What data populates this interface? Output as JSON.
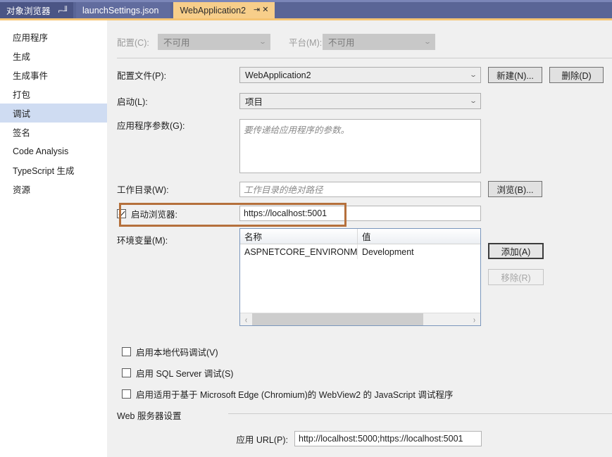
{
  "window": {
    "tabs": [
      {
        "label": "对象浏览器",
        "type": "dock",
        "pin_icon": "pin-icon",
        "active": false
      },
      {
        "label": "launchSettings.json",
        "type": "document",
        "active": false
      },
      {
        "label": "WebApplication2",
        "type": "document",
        "active": true,
        "pin_icon": "pin-icon",
        "close_icon": "close-icon"
      }
    ]
  },
  "sidebar": {
    "items": [
      {
        "label": "应用程序",
        "selected": false
      },
      {
        "label": "生成",
        "selected": false
      },
      {
        "label": "生成事件",
        "selected": false
      },
      {
        "label": "打包",
        "selected": false
      },
      {
        "label": "调试",
        "selected": true
      },
      {
        "label": "签名",
        "selected": false
      },
      {
        "label": "Code Analysis",
        "selected": false
      },
      {
        "label": "TypeScript 生成",
        "selected": false
      },
      {
        "label": "资源",
        "selected": false
      }
    ]
  },
  "top_bar": {
    "configuration_label": "配置(C):",
    "configuration_value": "不可用",
    "platform_label": "平台(M):",
    "platform_value": "不可用"
  },
  "form": {
    "profile_label": "配置文件(P):",
    "profile_value": "WebApplication2",
    "new_button": "新建(N)...",
    "delete_button": "删除(D)",
    "launch_label": "启动(L):",
    "launch_value": "项目",
    "app_args_label": "应用程序参数(G):",
    "app_args_placeholder": "要传递给应用程序的参数。",
    "app_args_value": "",
    "working_dir_label": "工作目录(W):",
    "working_dir_placeholder": "工作目录的绝对路径",
    "working_dir_value": "",
    "browse_button": "浏览(B)...",
    "launch_browser_label": "启动浏览器:",
    "launch_browser_checked": true,
    "launch_browser_url": "https://localhost:5001",
    "env_vars_label": "环境变量(M):",
    "add_button": "添加(A)",
    "remove_button": "移除(R)"
  },
  "env_grid": {
    "columns": [
      "名称",
      "值"
    ],
    "rows": [
      {
        "name": "ASPNETCORE_ENVIRONMENT",
        "value": "Development"
      }
    ],
    "scroll_left_icon": "chevron-left-icon",
    "scroll_right_icon": "chevron-right-icon"
  },
  "checkboxes": [
    {
      "label": "启用本地代码调试(V)",
      "checked": false
    },
    {
      "label": "启用 SQL Server 调试(S)",
      "checked": false
    },
    {
      "label": "启用适用于基于 Microsoft Edge (Chromium)的 WebView2 的 JavaScript 调试程序",
      "checked": false
    }
  ],
  "web_server": {
    "section_title": "Web 服务器设置",
    "app_url_label": "应用 URL(P):",
    "app_url_value": "http://localhost:5000;https://localhost:5001"
  },
  "colors": {
    "tab_active_bg": "#f7ce8a",
    "tab_bar_bg": "#5a6596",
    "tab_underline": "#f5c473",
    "sidebar_selected": "#cfdcf2",
    "annotation": "#b5703c",
    "content_bg": "#f0f0f0"
  },
  "annotation": {
    "name": "highlight-rectangle-launch-browser"
  }
}
